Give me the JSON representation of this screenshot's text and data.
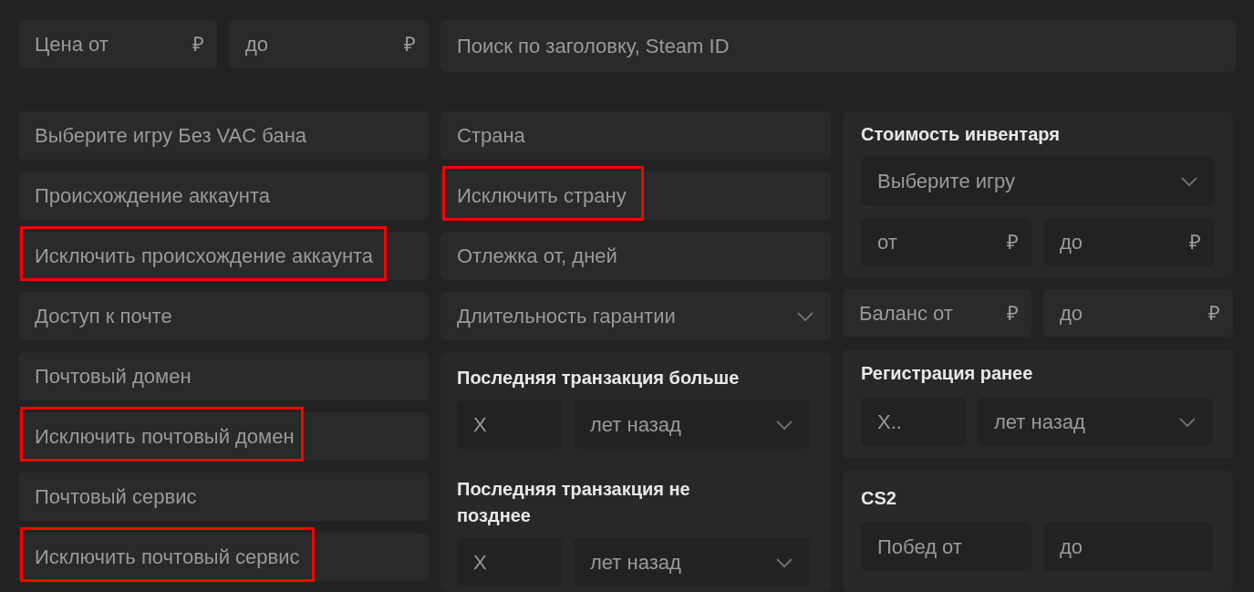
{
  "price": {
    "from": {
      "placeholder": "Цена от",
      "currency": "₽"
    },
    "to": {
      "placeholder": "до",
      "currency": "₽"
    }
  },
  "search": {
    "placeholder": "Поиск по заголовку, Steam ID"
  },
  "left_fields": [
    {
      "kind": "input",
      "placeholder": "Выберите игру Без VAC бана",
      "highlighted": false
    },
    {
      "kind": "input",
      "placeholder": "Происхождение аккаунта",
      "highlighted": false
    },
    {
      "kind": "input",
      "placeholder": "Исключить происхождение аккаунта",
      "highlighted": true
    },
    {
      "kind": "input",
      "placeholder": "Доступ к почте",
      "highlighted": false
    },
    {
      "kind": "input",
      "placeholder": "Почтовый домен",
      "highlighted": false
    },
    {
      "kind": "input",
      "placeholder": "Исключить почтовый домен",
      "highlighted": true
    },
    {
      "kind": "input",
      "placeholder": "Почтовый сервис",
      "highlighted": false
    },
    {
      "kind": "input",
      "placeholder": "Исключить почтовый сервис",
      "highlighted": true
    }
  ],
  "middle_fields": [
    {
      "kind": "input",
      "placeholder": "Страна",
      "highlighted": false
    },
    {
      "kind": "input",
      "placeholder": "Исключить страну",
      "highlighted": true
    },
    {
      "kind": "input",
      "placeholder": "Отлежка от, дней",
      "highlighted": false
    },
    {
      "kind": "select",
      "placeholder": "Длительность гарантии",
      "highlighted": false
    }
  ],
  "transaction_panels": [
    {
      "title": "Последняя транзакция больше",
      "amount": {
        "placeholder": "X"
      },
      "unit": {
        "value": "лет назад"
      }
    },
    {
      "title": "Последняя транзакция не позднее",
      "amount": {
        "placeholder": "X"
      },
      "unit": {
        "value": "лет назад"
      }
    }
  ],
  "inventory_panel": {
    "title": "Стоимость инвентаря",
    "game_select": {
      "placeholder": "Выберите игру"
    },
    "from": {
      "placeholder": "от",
      "currency": "₽"
    },
    "to": {
      "placeholder": "до",
      "currency": "₽"
    }
  },
  "balance": {
    "from": {
      "placeholder": "Баланс от",
      "currency": "₽"
    },
    "to": {
      "placeholder": "до",
      "currency": "₽"
    }
  },
  "registration_panel": {
    "title": "Регистрация ранее",
    "amount": {
      "placeholder": "X.."
    },
    "unit": {
      "value": "лет назад"
    }
  },
  "cs2_panel": {
    "title": "CS2",
    "wins_from": {
      "placeholder": "Побед от"
    },
    "wins_to": {
      "placeholder": "до"
    }
  }
}
